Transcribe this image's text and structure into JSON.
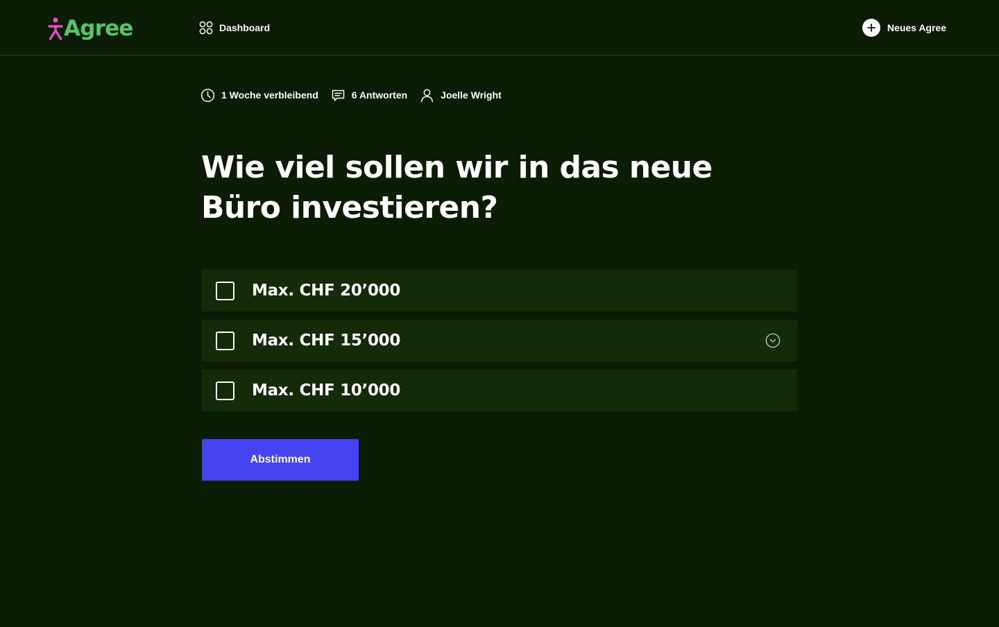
{
  "brand": {
    "name": "Agree",
    "figure_color": "#e14fc3",
    "text_color": "#55c46a"
  },
  "nav": {
    "dashboard_label": "Dashboard",
    "dashboard_icon": "grid-icon"
  },
  "actions": {
    "new_label": "Neues Agree",
    "new_icon": "plus-icon"
  },
  "meta": {
    "remaining": {
      "icon": "clock-icon",
      "text": "1 Woche verbleibend"
    },
    "answers": {
      "icon": "comment-icon",
      "text": "6 Antworten"
    },
    "author": {
      "icon": "user-icon",
      "text": "Joelle Wright"
    }
  },
  "question": "Wie viel sollen wir in das neue Büro investieren?",
  "options": [
    {
      "label": "Max. CHF 20’000",
      "checked": false
    },
    {
      "label": "Max. CHF 15’000",
      "checked": false,
      "has_expand": true
    },
    {
      "label": "Max. CHF 10’000",
      "checked": false
    }
  ],
  "vote_button": {
    "label": "Abstimmen",
    "color": "#4543f0"
  },
  "colors": {
    "background": "#0a1c03",
    "option_background": "#142b0a"
  }
}
